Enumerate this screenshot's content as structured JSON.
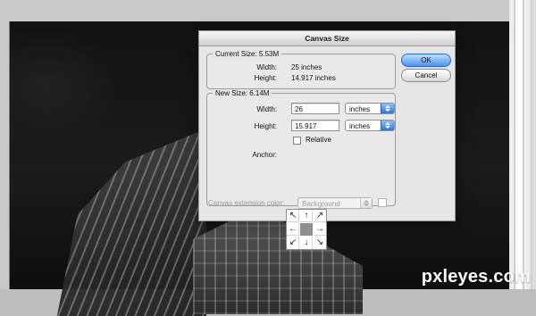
{
  "dialog": {
    "title": "Canvas Size",
    "current": {
      "label": "Current Size: 5.53M",
      "width_label": "Width:",
      "width_value": "25 inches",
      "height_label": "Height:",
      "height_value": "14.917 inches"
    },
    "new": {
      "label": "New Size: 6.14M",
      "width_label": "Width:",
      "width_value": "26",
      "width_unit": "inches",
      "height_label": "Height:",
      "height_value": "15.917",
      "height_unit": "inches",
      "relative_label": "Relative",
      "anchor_label": "Anchor:"
    },
    "buttons": {
      "ok": "OK",
      "cancel": "Cancel"
    },
    "extension": {
      "label": "Canvas extension color:",
      "value": "Background"
    }
  },
  "anchor_arrows": [
    "↖",
    "↑",
    "↗",
    "←",
    "",
    "→",
    "↙",
    "↓",
    "↘"
  ],
  "watermark": "pxleyes.com",
  "icons": {
    "dropdown": "chevron-updown-icon",
    "arrows": "arrow-icons"
  },
  "colors": {
    "ok_button": "#4a92f0",
    "dialog_bg": "#e6e6e6"
  }
}
